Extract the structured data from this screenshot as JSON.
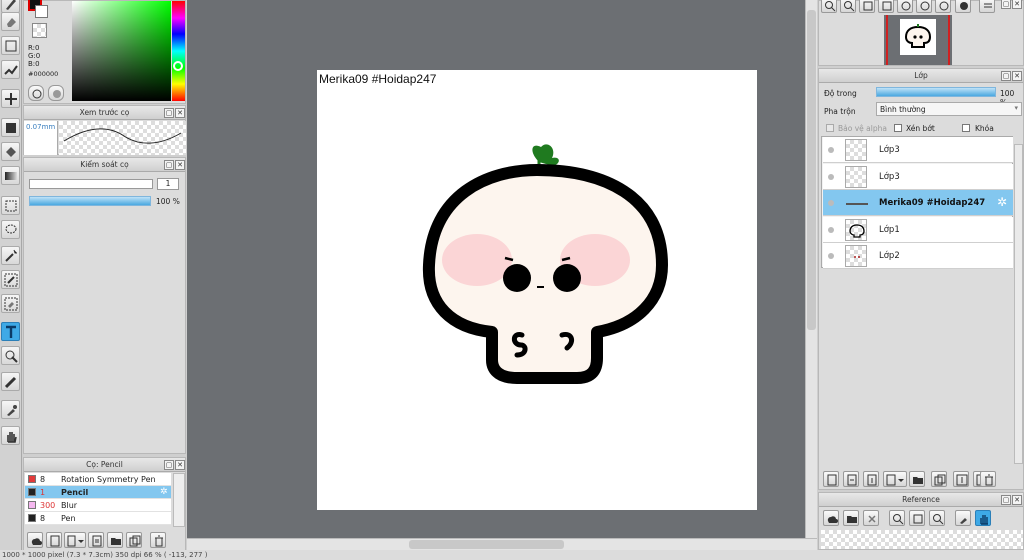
{
  "color_panel": {
    "r_label": "R:0",
    "g_label": "G:0",
    "b_label": "B:0",
    "hex": "#000000"
  },
  "brush_preview": {
    "title": "Xem trước cọ",
    "size_label": "0.07mm"
  },
  "brush_control": {
    "title": "Kiểm soát cọ",
    "size_value": "1",
    "opacity_value": "100 %"
  },
  "brush_list": {
    "title": "Cọ: Pencil",
    "items": [
      {
        "size": "8",
        "name": "Rotation Symmetry Pen",
        "color": "#e23b3b"
      },
      {
        "size": "1",
        "name": "Pencil",
        "color": "#222222"
      },
      {
        "size": "300",
        "name": "Blur",
        "color": "#f5b8f0"
      },
      {
        "size": "8",
        "name": "Pen",
        "color": "#222222"
      }
    ]
  },
  "canvas": {
    "label": "Merika09 #Hoidap247"
  },
  "status_bar": {
    "text": "1000 * 1000 pixel  (7.3 * 7.3cm)  350 dpi  66 %  ( -113, 277 )"
  },
  "layer_panel": {
    "title": "Lớp",
    "opacity_label": "Độ trong",
    "opacity_value": "100 %",
    "blend_label": "Pha trộn",
    "blend_value": "Bình thường",
    "alpha_label": "Bảo vệ alpha",
    "clip_label": "Xén bớt",
    "lock_label": "Khóa",
    "layers": [
      {
        "name": "Lớp3"
      },
      {
        "name": "Lớp3"
      },
      {
        "name": "Merika09 #Hoidap247"
      },
      {
        "name": "Lớp1"
      },
      {
        "name": "Lớp2"
      }
    ]
  },
  "reference_panel": {
    "title": "Reference"
  },
  "colors": {
    "accent": "#3ea9e6",
    "selection": "#83c7ef",
    "workspace": "#6c6f73"
  }
}
